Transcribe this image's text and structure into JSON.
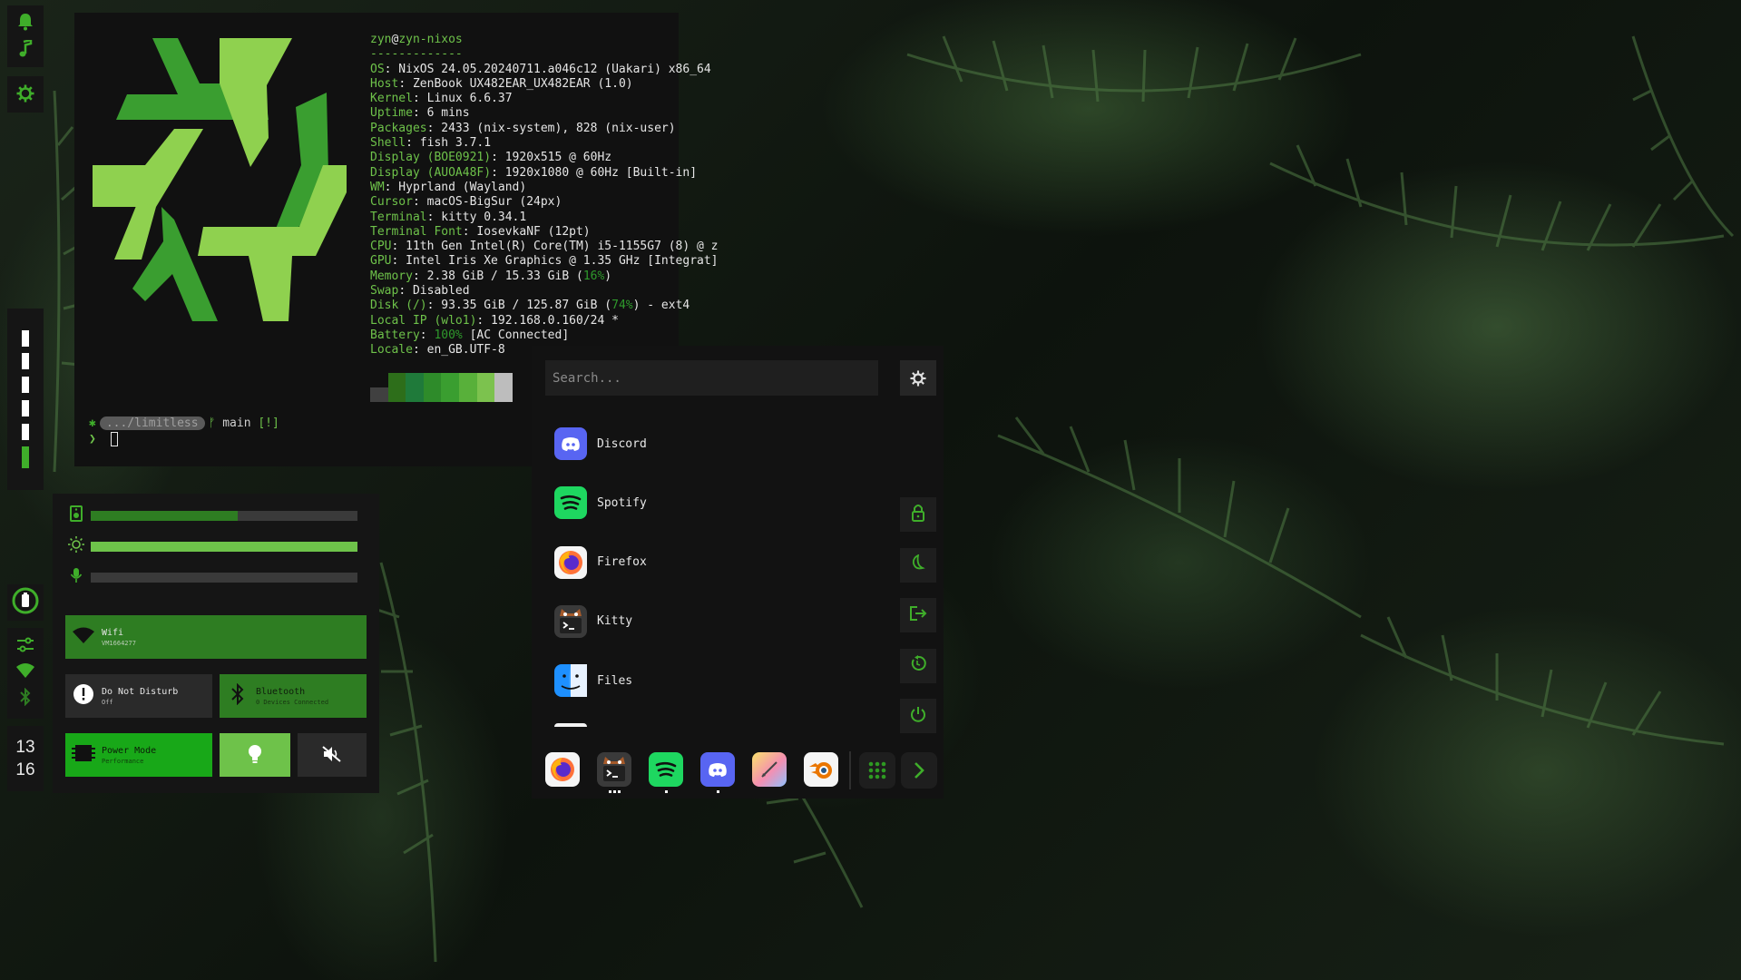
{
  "colors": {
    "accent": "#3fae2a",
    "accent_light": "#6ec24a",
    "panel": "#151515"
  },
  "sidebar": {
    "top_icons": [
      "bell-icon",
      "music-note-icon"
    ],
    "settings_icon": "gear-icon",
    "workspaces": [
      {
        "active": false
      },
      {
        "active": false
      },
      {
        "active": false
      },
      {
        "active": false
      },
      {
        "active": false
      },
      {
        "active": true
      }
    ],
    "battery_icon": "battery-icon",
    "controls_icons": [
      "sliders-icon",
      "wifi-icon",
      "bluetooth-icon"
    ],
    "clock": {
      "hour": "13",
      "minute": "16"
    }
  },
  "terminal": {
    "user": "zyn",
    "at": "@",
    "host": "zyn-nixos",
    "rule": "-------------",
    "fetch": [
      {
        "key": "OS",
        "value": ": NixOS 24.05.20240711.a046c12 (Uakari) x86_64"
      },
      {
        "key": "Host",
        "value": ": ZenBook UX482EAR_UX482EAR (1.0)"
      },
      {
        "key": "Kernel",
        "value": ": Linux 6.6.37"
      },
      {
        "key": "Uptime",
        "value": ": 6 mins"
      },
      {
        "key": "Packages",
        "value": ": 2433 (nix-system), 828 (nix-user)"
      },
      {
        "key": "Shell",
        "value": ": fish 3.7.1"
      },
      {
        "key": "Display (BOE0921)",
        "value": ": 1920x515 @ 60Hz"
      },
      {
        "key": "Display (AUOA48F)",
        "value": ": 1920x1080 @ 60Hz [Built-in]"
      },
      {
        "key": "WM",
        "value": ": Hyprland (Wayland)"
      },
      {
        "key": "Cursor",
        "value": ": macOS-BigSur (24px)"
      },
      {
        "key": "Terminal",
        "value": ": kitty 0.34.1"
      },
      {
        "key": "Terminal Font",
        "value": ": IosevkaNF (12pt)"
      },
      {
        "key": "CPU",
        "value": ": 11th Gen Intel(R) Core(TM) i5-1155G7 (8) @ z"
      },
      {
        "key": "GPU",
        "value": ": Intel Iris Xe Graphics @ 1.35 GHz [Integrat]"
      }
    ],
    "memory": {
      "key": "Memory",
      "pre": ": 2.38 GiB / 15.33 GiB (",
      "pct": "16%",
      "post": ")"
    },
    "swap": {
      "key": "Swap",
      "value": ": Disabled"
    },
    "disk": {
      "key": "Disk (/)",
      "pre": ": 93.35 GiB / 125.87 GiB (",
      "pct": "74%",
      "post": ") - ext4"
    },
    "localip": {
      "key": "Local IP (wlo1)",
      "value": ": 192.168.0.160/24 *"
    },
    "battery": {
      "key": "Battery",
      "pre": ": ",
      "pct": "100%",
      "post": " [AC Connected]"
    },
    "locale": {
      "key": "Locale",
      "value": ": en_GB.UTF-8"
    },
    "palette": [
      "#404040",
      "#2d6e1a",
      "#1f7a3a",
      "#2e8b2a",
      "#3a9e30",
      "#58b03a",
      "#7cc24e",
      "#bdbdbd"
    ],
    "prompt": {
      "dir": ".../limitless",
      "branch_glyph": "ᚠ",
      "branch": "main",
      "status": "[!]",
      "arrow": "❯"
    }
  },
  "quick_settings": {
    "volume_level": 0.55,
    "brightness_level": 1.0,
    "mic_level": 0.0,
    "wifi": {
      "title": "Wifi",
      "subtitle": "VM1664277"
    },
    "dnd": {
      "title": "Do Not Disturb",
      "subtitle": "Off"
    },
    "bluetooth": {
      "title": "Bluetooth",
      "subtitle": "0 Devices Connected"
    },
    "power": {
      "title": "Power Mode",
      "subtitle": "Performance"
    }
  },
  "launcher": {
    "search_placeholder": "Search...",
    "apps": [
      {
        "name": "Discord",
        "icon": "discord-icon"
      },
      {
        "name": "Spotify",
        "icon": "spotify-icon"
      },
      {
        "name": "Firefox",
        "icon": "firefox-icon"
      },
      {
        "name": "Kitty",
        "icon": "kitty-icon"
      },
      {
        "name": "Files",
        "icon": "finder-icon"
      }
    ],
    "power_buttons": [
      "lock-icon",
      "moon-icon",
      "logout-icon",
      "restart-icon",
      "power-icon"
    ]
  },
  "dock": {
    "items": [
      "firefox-icon",
      "kitty-icon",
      "spotify-icon",
      "discord-icon",
      "gradient-app-icon",
      "blender-icon"
    ],
    "app_grid_icon": "grid-icon",
    "next_icon": "chevron-right-icon"
  }
}
